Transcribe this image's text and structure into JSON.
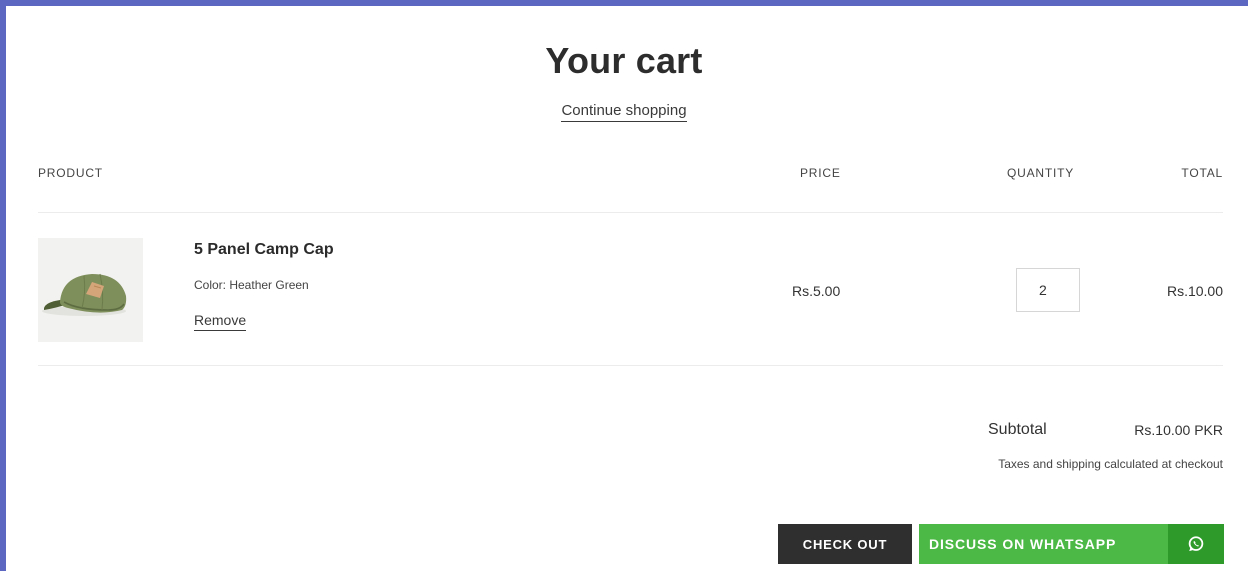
{
  "header": {
    "title": "Your cart",
    "continue_label": "Continue shopping"
  },
  "table": {
    "headers": {
      "product": "PRODUCT",
      "price": "PRICE",
      "quantity": "QUANTITY",
      "total": "TOTAL"
    },
    "items": [
      {
        "name": "5 Panel Camp Cap",
        "variant": "Color: Heather Green",
        "remove_label": "Remove",
        "price": "Rs.5.00",
        "quantity": "2",
        "total": "Rs.10.00",
        "image_icon": "cap-image"
      }
    ]
  },
  "summary": {
    "subtotal_label": "Subtotal",
    "subtotal_value": "Rs.10.00 PKR",
    "tax_note": "Taxes and shipping calculated at checkout"
  },
  "actions": {
    "checkout_label": "CHECK OUT",
    "whatsapp_label": "DISCUSS ON WHATSAPP",
    "whatsapp_icon": "whatsapp-icon"
  },
  "colors": {
    "frame_border": "#5b67c0",
    "checkout_bg": "#2f2f2f",
    "whatsapp_bg": "#4cb845",
    "whatsapp_icon_bg": "#2e9a2a"
  }
}
